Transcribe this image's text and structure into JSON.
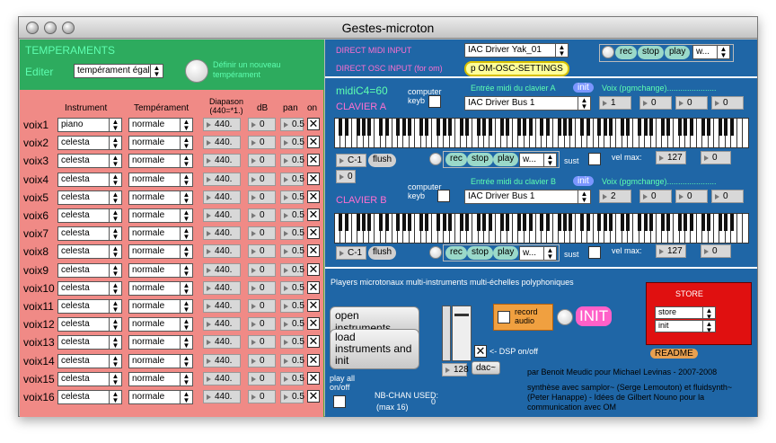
{
  "window": {
    "title": "Gestes-microton"
  },
  "left": {
    "header": "TEMPERAMENTS",
    "edit_label": "Editer",
    "temperament_select": "tempérament égal",
    "define_new": "Définir un nouveau tempérament",
    "columns": {
      "instrument": "Instrument",
      "temperament": "Tempérament",
      "diapason": "Diapason (440=*1.)",
      "db": "dB",
      "pan": "pan",
      "on": "on"
    },
    "voices": [
      {
        "name": "voix1",
        "instrument": "piano",
        "temperament": "normale",
        "diapason": "440.",
        "db": "0",
        "pan": "0.5",
        "on": "✕"
      },
      {
        "name": "voix2",
        "instrument": "celesta",
        "temperament": "normale",
        "diapason": "440.",
        "db": "0",
        "pan": "0.5",
        "on": "✕"
      },
      {
        "name": "voix3",
        "instrument": "celesta",
        "temperament": "normale",
        "diapason": "440.",
        "db": "0",
        "pan": "0.5",
        "on": "✕"
      },
      {
        "name": "voix4",
        "instrument": "celesta",
        "temperament": "normale",
        "diapason": "440.",
        "db": "0",
        "pan": "0.5",
        "on": "✕"
      },
      {
        "name": "voix5",
        "instrument": "celesta",
        "temperament": "normale",
        "diapason": "440.",
        "db": "0",
        "pan": "0.5",
        "on": "✕"
      },
      {
        "name": "voix6",
        "instrument": "celesta",
        "temperament": "normale",
        "diapason": "440.",
        "db": "0",
        "pan": "0.5",
        "on": "✕"
      },
      {
        "name": "voix7",
        "instrument": "celesta",
        "temperament": "normale",
        "diapason": "440.",
        "db": "0",
        "pan": "0.5",
        "on": "✕"
      },
      {
        "name": "voix8",
        "instrument": "celesta",
        "temperament": "normale",
        "diapason": "440.",
        "db": "0",
        "pan": "0.5",
        "on": "✕"
      },
      {
        "name": "voix9",
        "instrument": "celesta",
        "temperament": "normale",
        "diapason": "440.",
        "db": "0",
        "pan": "0.5",
        "on": "✕"
      },
      {
        "name": "voix10",
        "instrument": "celesta",
        "temperament": "normale",
        "diapason": "440.",
        "db": "0",
        "pan": "0.5",
        "on": "✕"
      },
      {
        "name": "voix11",
        "instrument": "celesta",
        "temperament": "normale",
        "diapason": "440.",
        "db": "0",
        "pan": "0.5",
        "on": "✕"
      },
      {
        "name": "voix12",
        "instrument": "celesta",
        "temperament": "normale",
        "diapason": "440.",
        "db": "0",
        "pan": "0.5",
        "on": "✕"
      },
      {
        "name": "voix13",
        "instrument": "celesta",
        "temperament": "normale",
        "diapason": "440.",
        "db": "0",
        "pan": "0.5",
        "on": "✕"
      },
      {
        "name": "voix14",
        "instrument": "celesta",
        "temperament": "normale",
        "diapason": "440.",
        "db": "0",
        "pan": "0.5",
        "on": "✕"
      },
      {
        "name": "voix15",
        "instrument": "celesta",
        "temperament": "normale",
        "diapason": "440.",
        "db": "0",
        "pan": "0.5",
        "on": "✕"
      },
      {
        "name": "voix16",
        "instrument": "celesta",
        "temperament": "normale",
        "diapason": "440.",
        "db": "0",
        "pan": "0.5",
        "on": "✕"
      }
    ]
  },
  "top": {
    "direct_midi": "DIRECT MIDI INPUT",
    "direct_osc": "DIRECT OSC INPUT (for om)",
    "midi_driver": "IAC Driver Yak_01",
    "osc_settings": "p OM-OSC-SETTINGS",
    "rec": "rec",
    "stop": "stop",
    "play": "play",
    "file": "w..."
  },
  "claviers": {
    "midic": "midiC4=60",
    "a": {
      "title": "CLAVIER A",
      "computer_keyb": "computer keyb",
      "entree": "Entrée midi du clavier A",
      "init": "init",
      "voix": "Voix (pgmchange)......................",
      "driver": "IAC Driver Bus 1",
      "v1": "1",
      "v2": "0",
      "v3": "0",
      "v4": "0",
      "octave": "C-1",
      "flush": "flush",
      "extra": "0",
      "rec": "rec",
      "stop": "stop",
      "play": "play",
      "file": "w...",
      "sust": "sust",
      "velmax": "vel max:",
      "vel": "127",
      "velb": "0"
    },
    "b": {
      "title": "CLAVIER B",
      "computer_keyb": "computer keyb",
      "entree": "Entrée midi du clavier B",
      "init": "init",
      "voix": "Voix (pgmchange)......................",
      "driver": "IAC Driver Bus 1",
      "v1": "2",
      "v2": "0",
      "v3": "0",
      "v4": "0",
      "octave": "C-1",
      "flush": "flush",
      "rec": "rec",
      "stop": "stop",
      "play": "play",
      "file": "w...",
      "sust": "sust",
      "velmax": "vel max:",
      "vel": "127",
      "velb": "0"
    }
  },
  "bottom": {
    "players": "Players microtonaux multi-instruments multi-échelles polyphoniques",
    "open_instruments": "open instruments",
    "load_init": "load instruments and init",
    "play_all": "play all on/off",
    "nbchan": "NB-CHAN USED:",
    "nbchan_max": "(max 16)",
    "nbchan_val": "0",
    "record_audio": "record audio",
    "init_big": "INIT",
    "dsp": "<- DSP on/off",
    "gain": "128",
    "dac": "dac~",
    "store_title": "STORE",
    "store_sel": "store",
    "init_sel": "init",
    "readme": "README",
    "credit": "par Benoit Meudic pour Michael Levinas - 2007-2008",
    "synth": "synthèse avec samplor~ (Serge Lemouton) et fluidsynth~ (Peter Hanappe) - Idées de Gilbert Nouno pour la communication avec OM"
  }
}
